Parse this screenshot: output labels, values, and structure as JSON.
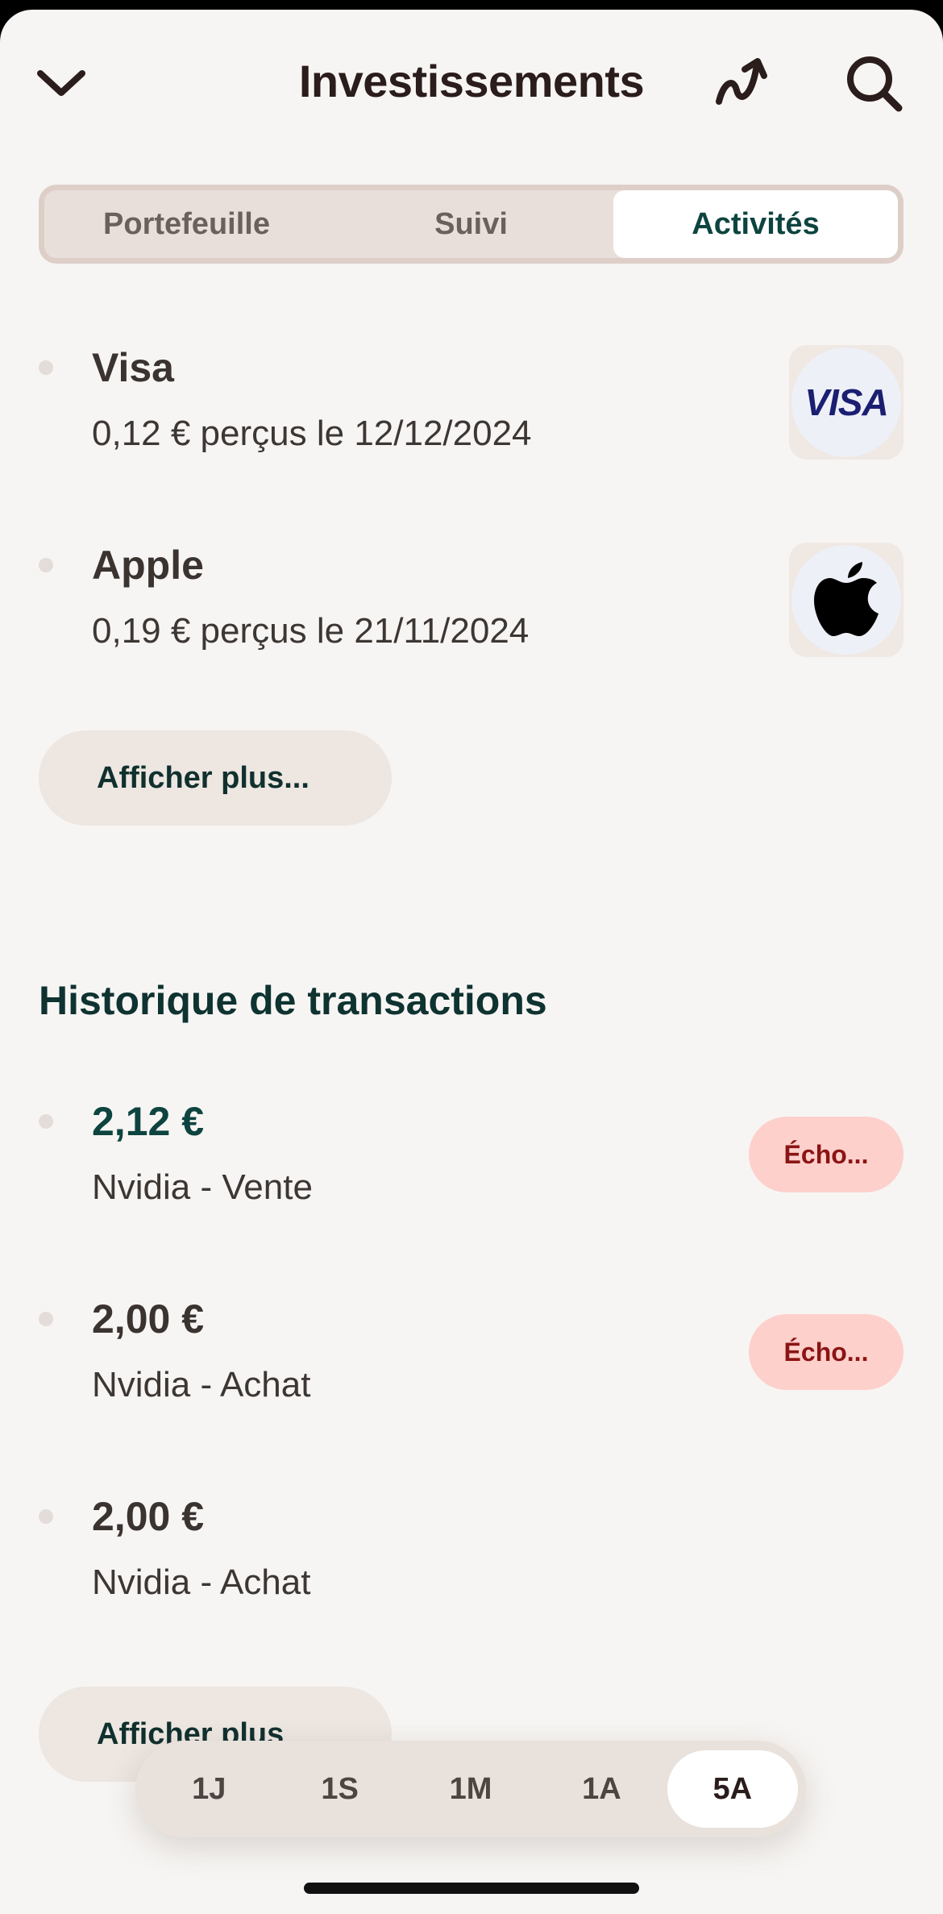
{
  "header": {
    "title": "Investissements",
    "back_icon": "chevron-down-icon",
    "trend_icon": "trend-arrow-icon",
    "search_icon": "search-icon"
  },
  "tabs": [
    {
      "label": "Portefeuille",
      "active": false
    },
    {
      "label": "Suivi",
      "active": false
    },
    {
      "label": "Activités",
      "active": true
    }
  ],
  "dividends": [
    {
      "title": "Visa",
      "subtitle": "0,12 € perçus le 12/12/2024",
      "logo": "visa-logo",
      "logo_text": "VISA"
    },
    {
      "title": "Apple",
      "subtitle": "0,19 € perçus le 21/11/2024",
      "logo": "apple-logo"
    }
  ],
  "dividends_more_label": "Afficher plus...",
  "transactions": {
    "title": "Historique de transactions",
    "items": [
      {
        "amount": "2,12 €",
        "subtitle": "Nvidia - Vente",
        "badge": "Écho..."
      },
      {
        "amount": "2,00 €",
        "subtitle": "Nvidia - Achat",
        "badge": "Écho..."
      },
      {
        "amount": "2,00 €",
        "subtitle": "Nvidia - Achat"
      }
    ],
    "more_label": "Afficher plus"
  },
  "periods": [
    {
      "label": "1J",
      "active": false
    },
    {
      "label": "1S",
      "active": false
    },
    {
      "label": "1M",
      "active": false
    },
    {
      "label": "1A",
      "active": false
    },
    {
      "label": "5A",
      "active": true
    }
  ],
  "colors": {
    "background": "#f7f5f3",
    "accent_green": "#0d4440",
    "badge_bg": "#fdd0cb",
    "badge_text": "#8b1414"
  }
}
